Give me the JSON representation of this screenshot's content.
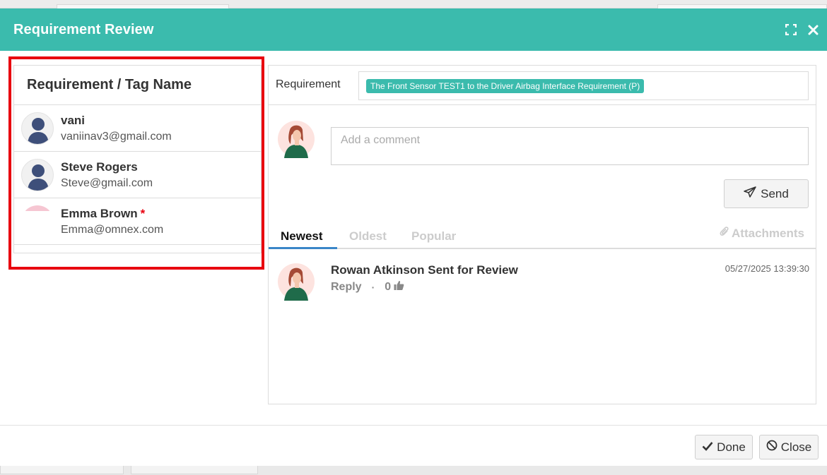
{
  "modal": {
    "title": "Requirement Review"
  },
  "left_panel": {
    "header": "Requirement / Tag Name",
    "users": [
      {
        "name": "vani",
        "email": "vaniinav3@gmail.com",
        "required": false
      },
      {
        "name": "Steve Rogers",
        "email": "Steve@gmail.com",
        "required": false
      },
      {
        "name": "Emma Brown",
        "email": "Emma@omnex.com",
        "required": true,
        "required_mark": "*"
      }
    ]
  },
  "requirement": {
    "label": "Requirement",
    "tag": "The Front Sensor TEST1 to the Driver Airbag Interface Requirement (P)"
  },
  "comment": {
    "placeholder": "Add a comment",
    "send_label": "Send"
  },
  "tabs": {
    "items": [
      "Newest",
      "Oldest",
      "Popular"
    ],
    "active": "Newest",
    "attachments_label": "Attachments"
  },
  "thread": {
    "title": "Rowan Atkinson Sent for Review",
    "date": "05/27/2025 13:39:30",
    "reply_label": "Reply",
    "separator": "·",
    "likes": "0"
  },
  "footer": {
    "done_label": "Done",
    "close_label": "Close"
  },
  "colors": {
    "header_teal": "#3bbbad",
    "highlight_red": "#e8000f",
    "tab_underline": "#3a86c8"
  },
  "icons": [
    "expand-icon",
    "close-icon",
    "avatar-silhouette-icon",
    "send-plane-icon",
    "paperclip-icon",
    "thumbs-up-icon",
    "check-icon",
    "ban-icon"
  ]
}
